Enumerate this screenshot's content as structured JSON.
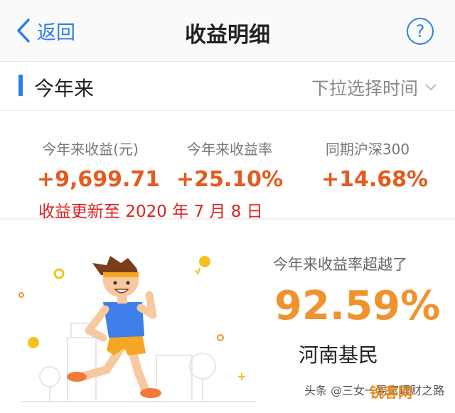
{
  "nav": {
    "back_label": "返回",
    "title": "收益明细",
    "help_glyph": "?"
  },
  "section": {
    "title": "今年来",
    "picker_label": "下拉选择时间",
    "accent_color": "#2f7ee6"
  },
  "stats": [
    {
      "label": "今年来收益(元)",
      "value": "+9,699.71"
    },
    {
      "label": "今年来收益率",
      "value": "+25.10%"
    },
    {
      "label": "同期沪深300",
      "value": "+14.68%"
    }
  ],
  "update_note": "收益更新至 2020 年 7 月 8 日",
  "beat": {
    "label": "今年来收益率超越了",
    "value": "92.59%",
    "region": "河南基民"
  },
  "watermark": {
    "text": "头条 @三女一易富理财之路",
    "logo": "锐客网"
  },
  "colors": {
    "positive": "#e55a1f",
    "highlight": "#f0922e",
    "note": "#e02020"
  }
}
